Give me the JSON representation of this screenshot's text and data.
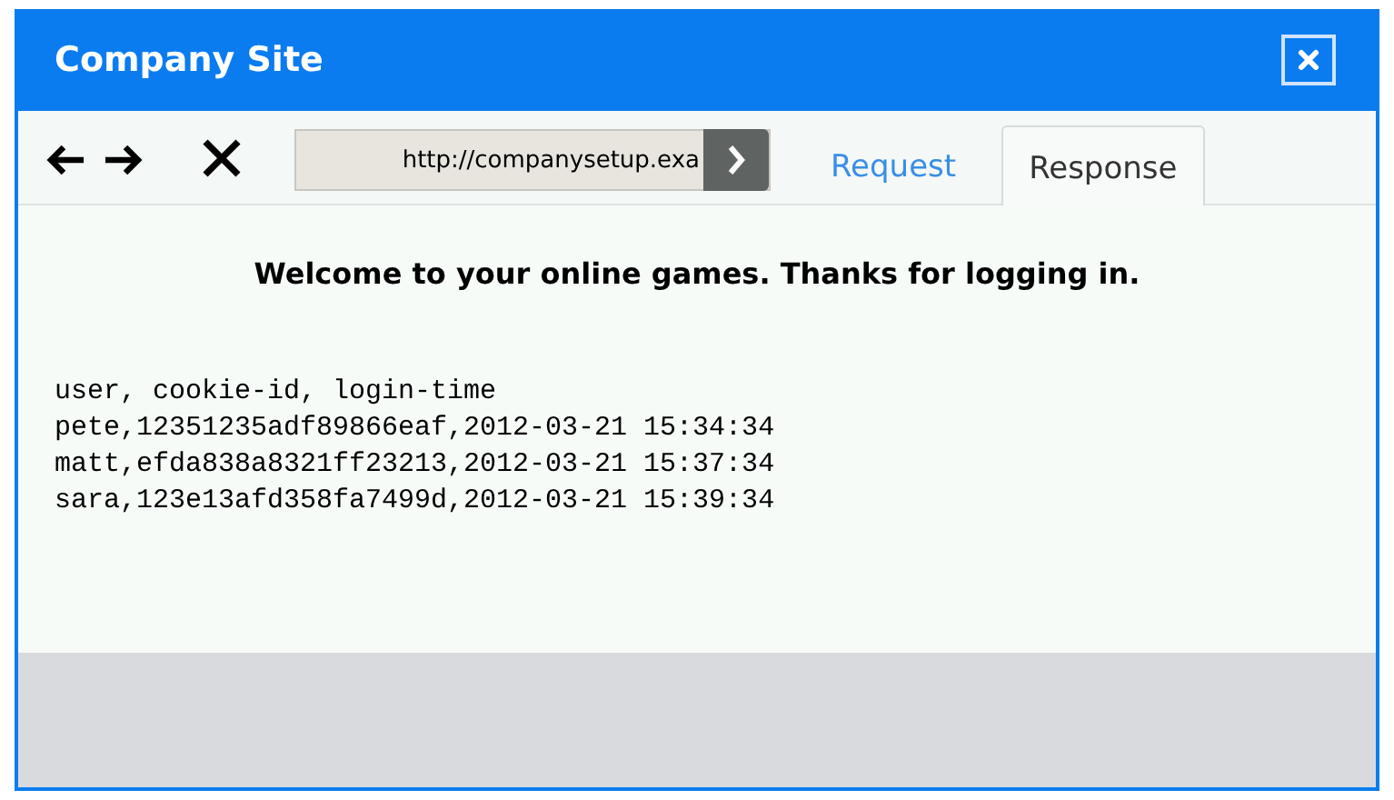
{
  "window": {
    "title": "Company Site"
  },
  "toolbar": {
    "address": "http://companysetup.exa"
  },
  "tabs": [
    {
      "label": "Request",
      "selected": false
    },
    {
      "label": "Response",
      "selected": true
    }
  ],
  "content": {
    "heading": "Welcome to your online games. Thanks for logging in.",
    "lines": [
      "user, cookie-id, login-time",
      "pete,12351235adf89866eaf,2012-03-21 15:34:34",
      "matt,efda838a8321ff23213,2012-03-21 15:37:34",
      "sara,123e13afd358fa7499d,2012-03-21 15:39:34"
    ]
  }
}
